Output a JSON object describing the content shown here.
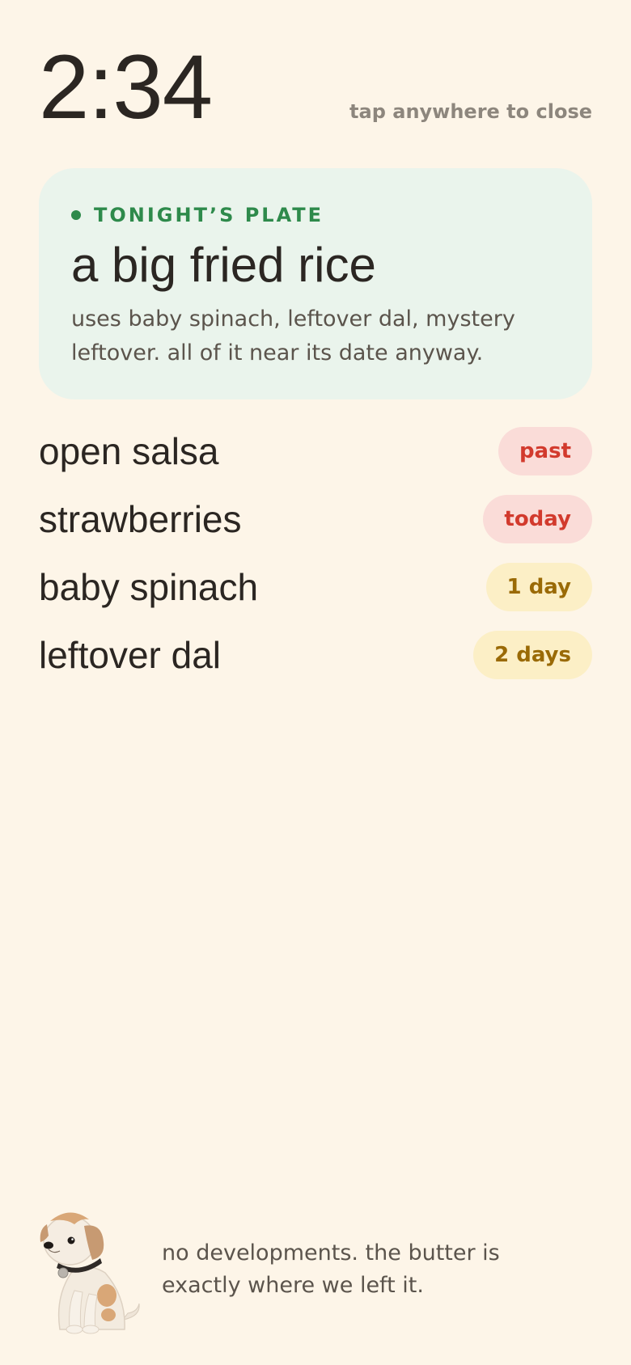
{
  "clock": {
    "time": "2:34"
  },
  "close_hint": "tap anywhere to close",
  "plate": {
    "eyebrow": "TONIGHT’S PLATE",
    "title": "a big fried rice",
    "description": "uses baby spinach, leftover dal, mystery leftover. all of it near its date anyway."
  },
  "items": [
    {
      "name": "open salsa",
      "badge": "past",
      "status": "red"
    },
    {
      "name": "strawberries",
      "badge": "today",
      "status": "red"
    },
    {
      "name": "baby spinach",
      "badge": "1 day",
      "status": "yellow"
    },
    {
      "name": "leftover dal",
      "badge": "2 days",
      "status": "yellow"
    }
  ],
  "colors": {
    "background": "#fdf5e8",
    "plate_card": "#eaf4ec",
    "accent_green": "#2e8a4b",
    "badge_red_bg": "#fadcd8",
    "badge_red_text": "#d23a2d",
    "badge_yellow_bg": "#fcefc6",
    "badge_yellow_text": "#9a6a06"
  },
  "footer": {
    "mascot_icon": "puppy-icon",
    "message": "no developments. the butter is exactly where we left it."
  }
}
